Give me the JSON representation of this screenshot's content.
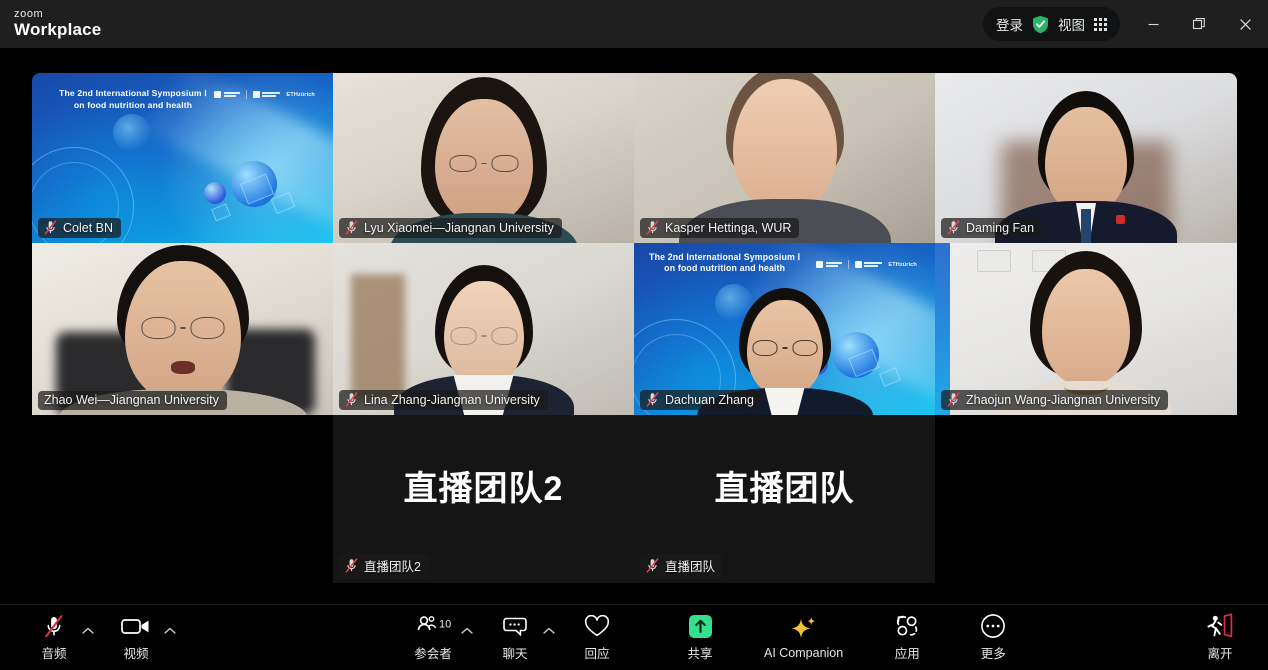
{
  "window": {
    "brand_line1": "zoom",
    "brand_line2": "Workplace",
    "login_label": "登录",
    "view_label": "视图",
    "minimize_tooltip": "最小化",
    "restore_tooltip": "还原",
    "close_tooltip": "关闭"
  },
  "meeting": {
    "virtual_background_title_line1": "The 2nd International Symposium  Ⅰ",
    "virtual_background_title_line2": "on food nutrition and health",
    "logo_eth_text": "ETHzürich",
    "participants": [
      {
        "name": "Colet BN",
        "muted": true,
        "active_speaker": false,
        "tile_type": "virtual-background"
      },
      {
        "name": "Lyu Xiaomei—Jiangnan University",
        "muted": true,
        "active_speaker": false,
        "tile_type": "video"
      },
      {
        "name": "Kasper Hettinga, WUR",
        "muted": true,
        "active_speaker": false,
        "tile_type": "video"
      },
      {
        "name": "Daming Fan",
        "muted": true,
        "active_speaker": false,
        "tile_type": "video"
      },
      {
        "name": "Zhao Wei—Jiangnan University",
        "muted": false,
        "active_speaker": true,
        "tile_type": "video"
      },
      {
        "name": "Lina Zhang-Jiangnan University",
        "muted": true,
        "active_speaker": false,
        "tile_type": "video"
      },
      {
        "name": "Dachuan Zhang",
        "muted": true,
        "active_speaker": false,
        "tile_type": "virtual-background"
      },
      {
        "name": "Zhaojun Wang-Jiangnan University",
        "muted": true,
        "active_speaker": false,
        "tile_type": "video"
      },
      {
        "name": "直播团队2",
        "muted": true,
        "active_speaker": false,
        "tile_type": "name-only",
        "display_text": "直播团队2"
      },
      {
        "name": "直播团队",
        "muted": true,
        "active_speaker": false,
        "tile_type": "name-only",
        "display_text": "直播团队"
      }
    ]
  },
  "toolbar": {
    "audio_label": "音频",
    "video_label": "视频",
    "participants_label": "参会者",
    "participants_count": "10",
    "chat_label": "聊天",
    "reactions_label": "回应",
    "share_label": "共享",
    "ai_companion_label": "AI Companion",
    "apps_label": "应用",
    "more_label": "更多",
    "leave_label": "离开"
  },
  "colors": {
    "active_speaker_border": "#36d576",
    "share_green": "#35e08d",
    "ai_yellow": "#f2c230",
    "leave_red": "#e02b45",
    "mute_red": "#e8404a",
    "shield_green": "#27b566"
  }
}
